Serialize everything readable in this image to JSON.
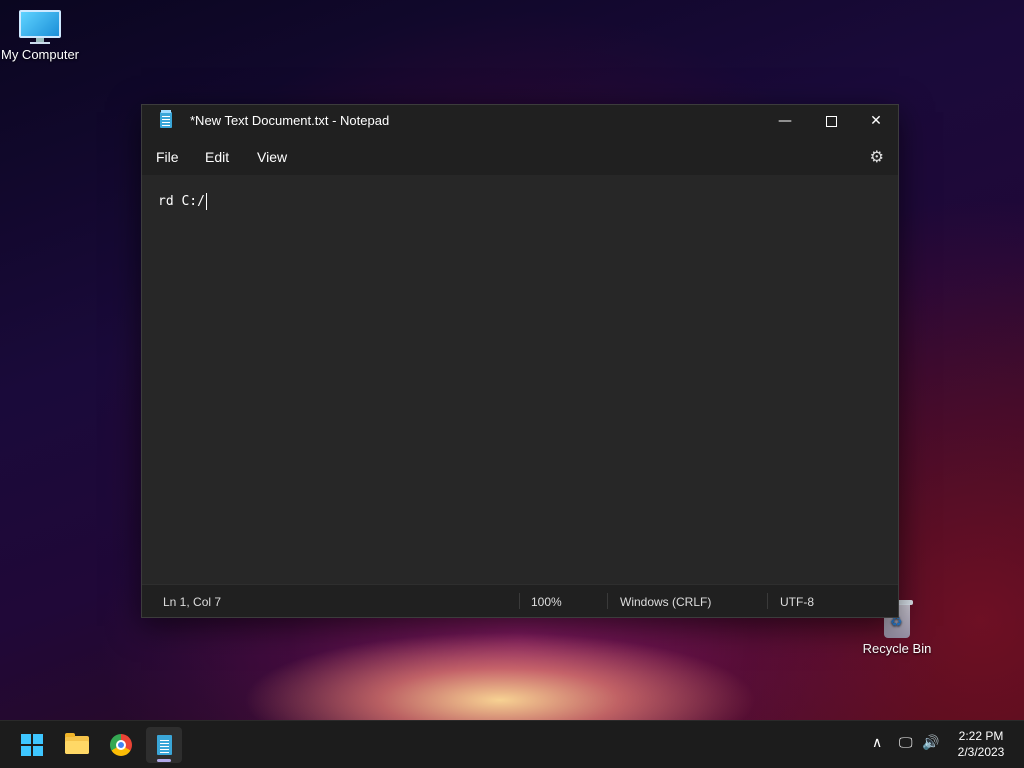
{
  "desktop": {
    "icons": [
      {
        "label": "My Computer",
        "icon": "computer-icon"
      },
      {
        "label": "Recycle Bin",
        "icon": "recycle-bin-icon"
      }
    ]
  },
  "window": {
    "title": "*New Text Document.txt - Notepad",
    "app_icon": "notepad-icon",
    "controls": {
      "minimize": "—",
      "close": "✕"
    }
  },
  "menu": {
    "file": "File",
    "edit": "Edit",
    "view": "View",
    "settings_icon": "⚙"
  },
  "editor": {
    "content": "rd C:/"
  },
  "status": {
    "position": "Ln 1, Col 7",
    "zoom": "100%",
    "line_ending": "Windows (CRLF)",
    "encoding": "UTF-8"
  },
  "taskbar": {
    "apps": [
      "start-icon",
      "file-explorer-icon",
      "chrome-icon",
      "notepad-icon"
    ],
    "tray": {
      "chevron": "∧",
      "network": "🖵",
      "volume": "🔊"
    },
    "time": "2:22 PM",
    "date": "2/3/2023"
  },
  "colors": {
    "accent": "#3ec6ff",
    "window_bg": "#272727",
    "titlebar_bg": "#202020"
  }
}
